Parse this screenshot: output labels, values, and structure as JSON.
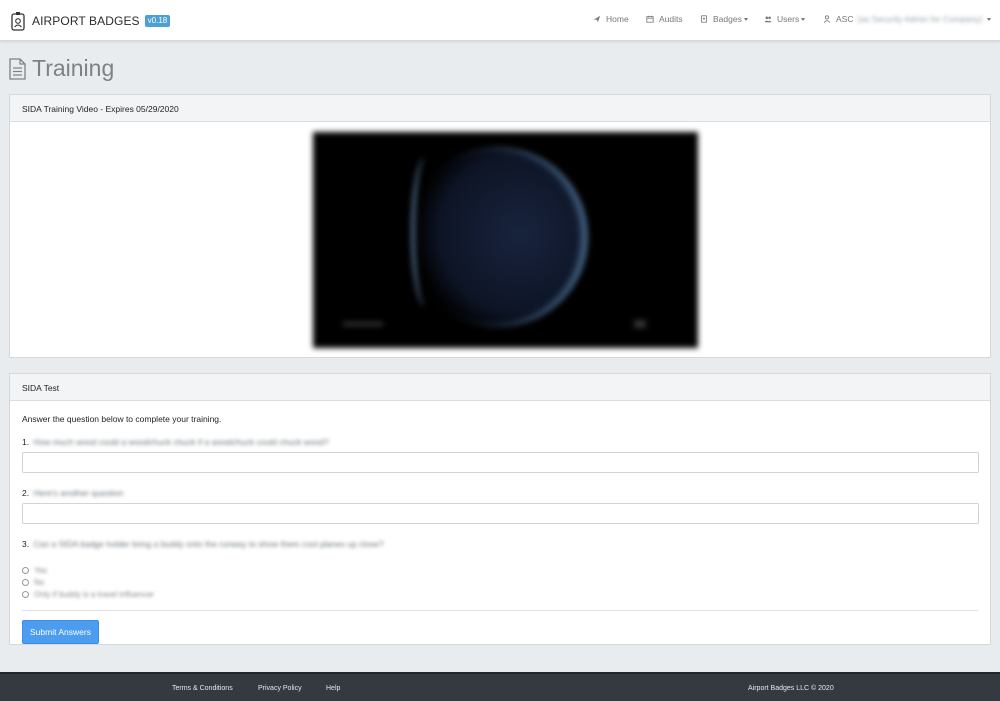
{
  "navbar": {
    "brand": "AIRPORT BADGES",
    "version": "v0.18",
    "home": "Home",
    "audits": "Audits",
    "badges": "Badges",
    "users": "Users",
    "account": "ASC",
    "account_detail": "(as Security Admin for Company)"
  },
  "page": {
    "title": "Training"
  },
  "video_card": {
    "header": "SIDA Training Video - Expires 05/29/2020"
  },
  "test_card": {
    "header": "SIDA Test",
    "intro": "Answer the question below to complete your training.",
    "q1_num": "1.",
    "q1_text": "How much wood could a woodchuck chuck if a woodchuck could chuck wood?",
    "q2_num": "2.",
    "q2_text": "Here's another question",
    "q3_num": "3.",
    "q3_text": "Can a SIDA badge holder bring a buddy onto the runway to show them cool planes up close?",
    "options": [
      "Yes",
      "No",
      "Only if buddy is a travel influencer"
    ],
    "submit": "Submit Answers"
  },
  "footer": {
    "terms": "Terms & Conditions",
    "privacy": "Privacy Policy",
    "help": "Help",
    "copyright": "Airport Badges LLC © 2020"
  }
}
